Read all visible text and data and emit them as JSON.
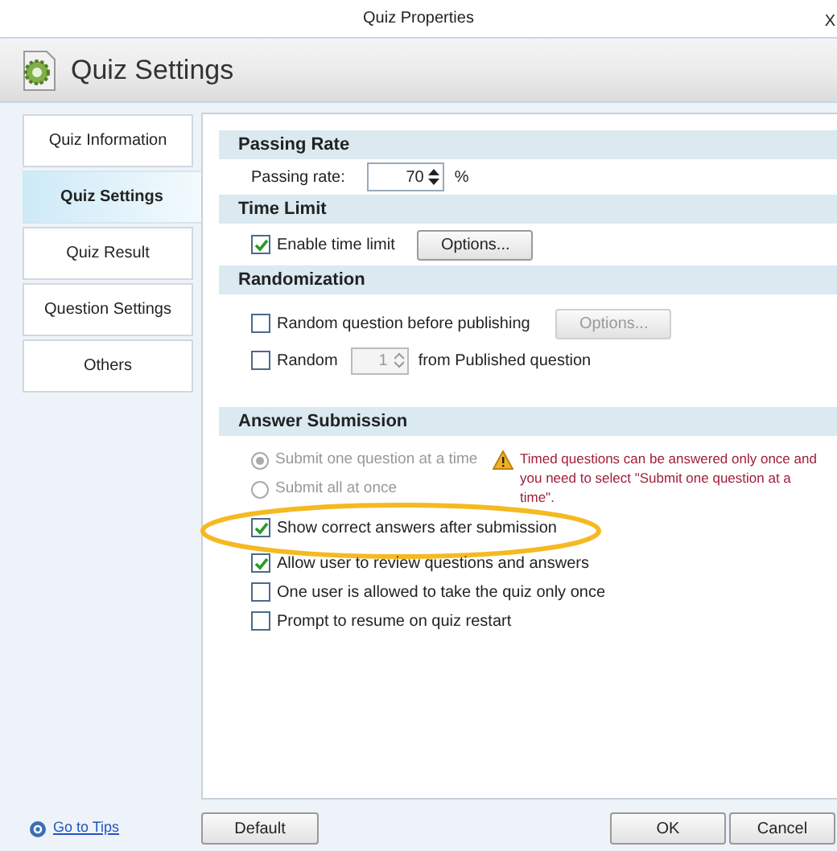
{
  "window": {
    "title": "Quiz Properties",
    "close": "X"
  },
  "header": {
    "title": "Quiz Settings"
  },
  "sidebar": {
    "items": [
      {
        "label": "Quiz Information",
        "selected": false
      },
      {
        "label": "Quiz Settings",
        "selected": true
      },
      {
        "label": "Quiz Result",
        "selected": false
      },
      {
        "label": "Question Settings",
        "selected": false
      },
      {
        "label": "Others",
        "selected": false
      }
    ]
  },
  "passing_rate": {
    "title": "Passing  Rate",
    "label": "Passing rate:",
    "value": "70",
    "unit": "%"
  },
  "time_limit": {
    "title": "Time Limit",
    "checkbox": {
      "label": "Enable time limit",
      "checked": true
    },
    "options_button": {
      "label": "Options...",
      "disabled": false
    }
  },
  "randomization": {
    "title": "Randomization",
    "before_publishing": {
      "label": "Random question before publishing",
      "checked": false
    },
    "options_button": {
      "label": "Options...",
      "disabled": true
    },
    "random": {
      "label": "Random",
      "checked": false,
      "value": "1",
      "suffix": "from Published question"
    }
  },
  "answer_submission": {
    "title": "Answer Submission",
    "radios": [
      {
        "label": "Submit one question at a time",
        "selected": true,
        "disabled": true
      },
      {
        "label": "Submit all at once",
        "selected": false,
        "disabled": true
      }
    ],
    "warning": "Timed questions can be answered only once and you need to select \"Submit one question at a time\".",
    "checkboxes": [
      {
        "label": "Show correct answers after submission",
        "checked": true,
        "highlighted": true
      },
      {
        "label": "Allow user to review questions and answers",
        "checked": true,
        "highlighted": false
      },
      {
        "label": "One user is allowed to take the quiz only once",
        "checked": false,
        "highlighted": false
      },
      {
        "label": "Prompt to resume on quiz restart",
        "checked": false,
        "highlighted": false
      }
    ]
  },
  "footer": {
    "tips_link": "Go to Tips",
    "buttons": [
      "Default",
      "OK",
      "Cancel"
    ]
  }
}
